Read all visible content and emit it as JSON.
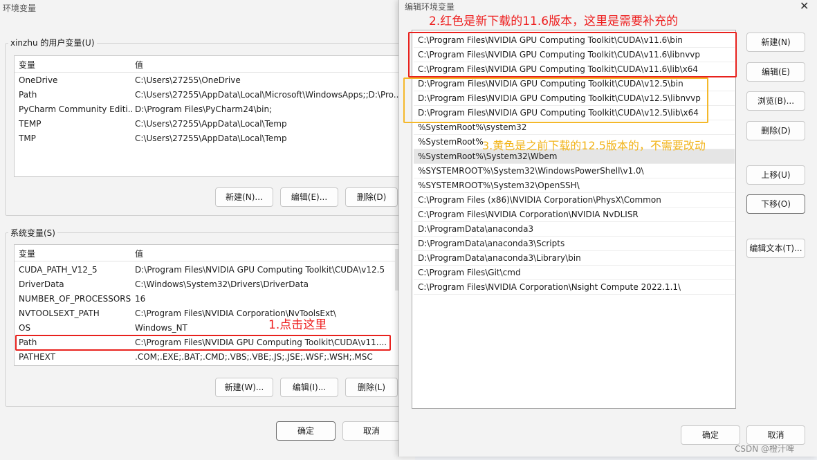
{
  "back_window": {
    "title": "环境变量",
    "user_group_label": "xinzhu 的用户变量(U)",
    "col_var": "变量",
    "col_val": "值",
    "user_rows": [
      {
        "name": "OneDrive",
        "value": "C:\\Users\\27255\\OneDrive"
      },
      {
        "name": "Path",
        "value": "C:\\Users\\27255\\AppData\\Local\\Microsoft\\WindowsApps;;D:\\Pro..."
      },
      {
        "name": "PyCharm Community Editi...",
        "value": "D:\\Program Files\\PyCharm24\\bin;"
      },
      {
        "name": "TEMP",
        "value": "C:\\Users\\27255\\AppData\\Local\\Temp"
      },
      {
        "name": "TMP",
        "value": "C:\\Users\\27255\\AppData\\Local\\Temp"
      }
    ],
    "user_buttons": {
      "new": "新建(N)...",
      "edit": "编辑(E)...",
      "delete": "删除(D)"
    },
    "system_group_label": "系统变量(S)",
    "system_rows": [
      {
        "name": "CUDA_PATH_V12_5",
        "value": "D:\\Program Files\\NVIDIA GPU Computing Toolkit\\CUDA\\v12.5"
      },
      {
        "name": "DriverData",
        "value": "C:\\Windows\\System32\\Drivers\\DriverData"
      },
      {
        "name": "NUMBER_OF_PROCESSORS",
        "value": "16"
      },
      {
        "name": "NVTOOLSEXT_PATH",
        "value": "C:\\Program Files\\NVIDIA Corporation\\NvToolsExt\\"
      },
      {
        "name": "OS",
        "value": "Windows_NT"
      },
      {
        "name": "Path",
        "value": "C:\\Program Files\\NVIDIA GPU Computing Toolkit\\CUDA\\v11...."
      },
      {
        "name": "PATHEXT",
        "value": ".COM;.EXE;.BAT;.CMD;.VBS;.VBE;.JS;.JSE;.WSF;.WSH;.MSC"
      }
    ],
    "system_buttons": {
      "new": "新建(W)...",
      "edit": "编辑(I)...",
      "delete": "删除(L)"
    },
    "ok": "确定",
    "cancel": "取消"
  },
  "dialog": {
    "title": "编辑环境变量",
    "items": [
      "C:\\Program Files\\NVIDIA GPU Computing Toolkit\\CUDA\\v11.6\\bin",
      "C:\\Program Files\\NVIDIA GPU Computing Toolkit\\CUDA\\v11.6\\libnvvp",
      "C:\\Program Files\\NVIDIA GPU Computing Toolkit\\CUDA\\v11.6\\lib\\x64",
      "D:\\Program Files\\NVIDIA GPU Computing Toolkit\\CUDA\\v12.5\\bin",
      "D:\\Program Files\\NVIDIA GPU Computing Toolkit\\CUDA\\v12.5\\libnvvp",
      "D:\\Program Files\\NVIDIA GPU Computing Toolkit\\CUDA\\v12.5\\lib\\x64",
      "%SystemRoot%\\system32",
      "%SystemRoot%",
      "%SystemRoot%\\System32\\Wbem",
      "%SYSTEMROOT%\\System32\\WindowsPowerShell\\v1.0\\",
      "%SYSTEMROOT%\\System32\\OpenSSH\\",
      "C:\\Program Files (x86)\\NVIDIA Corporation\\PhysX\\Common",
      "C:\\Program Files\\NVIDIA Corporation\\NVIDIA NvDLISR",
      "D:\\ProgramData\\anaconda3",
      "D:\\ProgramData\\anaconda3\\Scripts",
      "D:\\ProgramData\\anaconda3\\Library\\bin",
      "C:\\Program Files\\Git\\cmd",
      "C:\\Program Files\\NVIDIA Corporation\\Nsight Compute 2022.1.1\\"
    ],
    "buttons": {
      "new": "新建(N)",
      "edit": "编辑(E)",
      "browse": "浏览(B)...",
      "delete": "删除(D)",
      "move_up": "上移(U)",
      "move_down": "下移(O)",
      "edit_text": "编辑文本(T)...",
      "ok": "确定",
      "cancel": "取消"
    }
  },
  "annotations": {
    "red_note": "2.红色是新下载的11.6版本，这里是需要补充的",
    "yellow_note": "3.黄色是之前下载的12.5版本的，不需要改动",
    "click_note": "1.点击这里"
  },
  "watermark": "CSDN @橙汁啤",
  "colors": {
    "annotation_red": "#e8211d",
    "annotation_yellow": "#f4b82a"
  }
}
